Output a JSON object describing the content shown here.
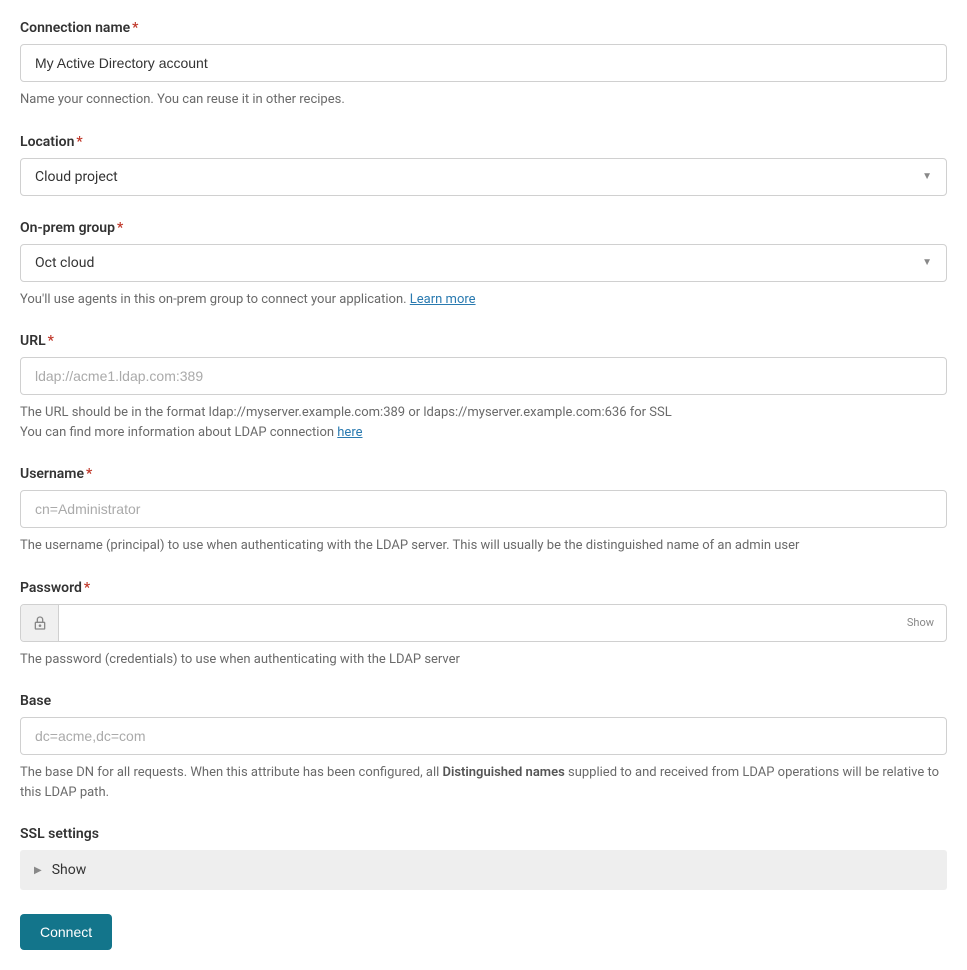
{
  "connection_name": {
    "label": "Connection name",
    "required": "*",
    "value": "My Active Directory account",
    "help": "Name your connection. You can reuse it in other recipes."
  },
  "location": {
    "label": "Location",
    "required": "*",
    "value": "Cloud project"
  },
  "on_prem_group": {
    "label": "On-prem group",
    "required": "*",
    "value": "Oct cloud",
    "help_prefix": "You'll use agents in this on-prem group to connect your application. ",
    "learn_more": "Learn more"
  },
  "url": {
    "label": "URL",
    "required": "*",
    "placeholder": "ldap://acme1.ldap.com:389",
    "help_line1": "The URL should be in the format ldap://myserver.example.com:389 or ldaps://myserver.example.com:636 for SSL",
    "help_line2_prefix": "You can find more information about LDAP connection ",
    "here_link": "here"
  },
  "username": {
    "label": "Username",
    "required": "*",
    "placeholder": "cn=Administrator",
    "help": "The username (principal) to use when authenticating with the LDAP server. This will usually be the distinguished name of an admin user"
  },
  "password": {
    "label": "Password",
    "required": "*",
    "show_text": "Show",
    "help": "The password (credentials) to use when authenticating with the LDAP server"
  },
  "base": {
    "label": "Base",
    "placeholder": "dc=acme,dc=com",
    "help_prefix": "The base DN for all requests. When this attribute has been configured, all ",
    "help_bold": "Distinguished names",
    "help_suffix": " supplied to and received from LDAP operations will be relative to this LDAP path."
  },
  "ssl_settings": {
    "label": "SSL settings",
    "show_text": "Show"
  },
  "connect_button": "Connect"
}
